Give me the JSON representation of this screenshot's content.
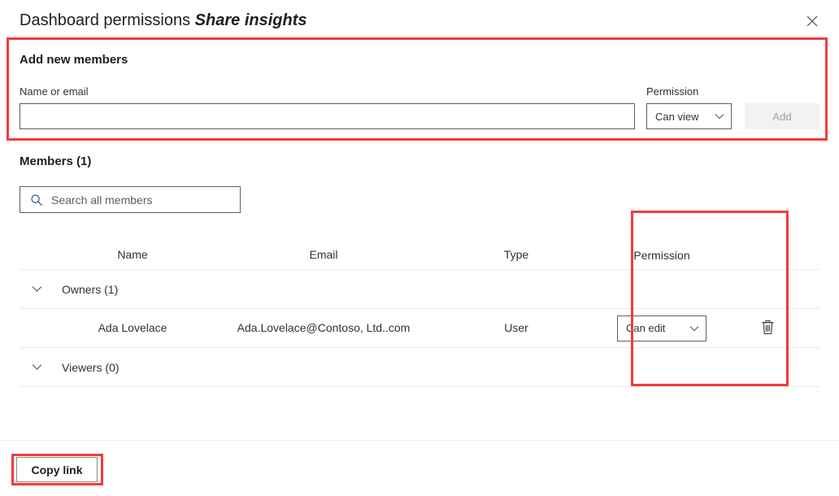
{
  "header": {
    "title_main": "Dashboard permissions",
    "title_emphasis": "Share insights",
    "close_icon": "close-icon"
  },
  "add_members": {
    "heading": "Add new members",
    "name_label": "Name or email",
    "name_value": "",
    "name_placeholder": "",
    "permission_label": "Permission",
    "permission_value": "Can view",
    "permission_options": [
      "Can view",
      "Can edit"
    ],
    "add_label": "Add",
    "add_disabled": true,
    "chevron_icon": "chevron-down-icon"
  },
  "members": {
    "heading": "Members (1)",
    "search_placeholder": "Search all members",
    "search_value": "",
    "search_icon": "search-icon",
    "columns": {
      "name": "Name",
      "email": "Email",
      "type": "Type",
      "permission": "Permission"
    },
    "groups": [
      {
        "label": "Owners (1)",
        "expanded": true,
        "chevron_icon": "chevron-down-icon",
        "rows": [
          {
            "name": "Ada Lovelace",
            "email": "Ada.Lovelace@Contoso, Ltd..com",
            "type": "User",
            "permission": "Can edit",
            "permission_options": [
              "Can view",
              "Can edit"
            ],
            "delete_icon": "trash-icon"
          }
        ]
      },
      {
        "label": "Viewers (0)",
        "expanded": true,
        "chevron_icon": "chevron-down-icon",
        "rows": []
      }
    ]
  },
  "footer": {
    "copy_link_label": "Copy link"
  },
  "annotations": {
    "color": "#f23b3b",
    "boxes": [
      "add-new-members-region",
      "permission-column-region",
      "copy-link-region"
    ]
  },
  "colors": {
    "accent_red": "#f23b3b",
    "text_primary": "#201f1e",
    "text_secondary": "#323130",
    "border": "#605e5c",
    "divider": "#edebe9",
    "disabled_bg": "#f3f2f1",
    "disabled_text": "#a19f9d",
    "search_icon_blue": "#2b579a"
  }
}
